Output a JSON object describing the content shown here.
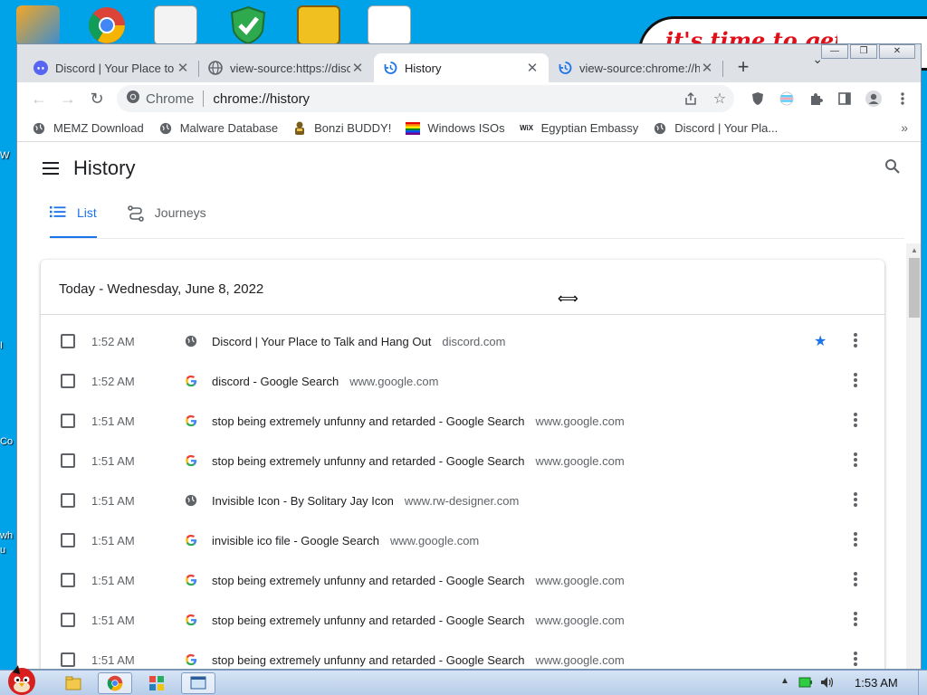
{
  "desktop": {
    "banner_text": "it's time to get chi",
    "left_fragments": [
      "W",
      "I",
      "Co",
      "wh",
      "u"
    ]
  },
  "window": {
    "controls": {
      "minimize": "—",
      "restore": "❐",
      "close": "✕"
    }
  },
  "tabs": [
    {
      "title": "Discord | Your Place to Talk and Hang Out",
      "icon": "discord-icon"
    },
    {
      "title": "view-source:https://discord.com",
      "icon": "globe-icon"
    },
    {
      "title": "History",
      "icon": "history-icon",
      "active": true
    },
    {
      "title": "view-source:chrome://history",
      "icon": "history-icon"
    }
  ],
  "toolbar": {
    "new_tab": "+",
    "tab_search": "⌄",
    "back": "←",
    "forward": "→",
    "reload": "↻",
    "omnibox_label": "Chrome",
    "url": "chrome://history"
  },
  "bookmarks": {
    "items": [
      {
        "label": "MEMZ Download",
        "icon": "globe-icon"
      },
      {
        "label": "Malware Database",
        "icon": "globe-icon"
      },
      {
        "label": "Bonzi BUDDY!",
        "icon": "bonzi-icon"
      },
      {
        "label": "Windows ISOs",
        "icon": "rainbow-flag-icon"
      },
      {
        "label": "Egyptian Embassy",
        "icon": "wix-icon"
      },
      {
        "label": "Discord | Your Pla...",
        "icon": "globe-icon"
      }
    ],
    "more": "»"
  },
  "history": {
    "title": "History",
    "subtabs": [
      {
        "label": "List",
        "active": true
      },
      {
        "label": "Journeys",
        "active": false
      }
    ],
    "day_heading": "Today - Wednesday, June 8, 2022",
    "rows": [
      {
        "time": "1:52 AM",
        "title": "Discord | Your Place to Talk and Hang Out",
        "domain": "discord.com",
        "favicon": "globe",
        "starred": true
      },
      {
        "time": "1:52 AM",
        "title": "discord - Google Search",
        "domain": "www.google.com",
        "favicon": "google",
        "starred": false
      },
      {
        "time": "1:51 AM",
        "title": "stop being extremely unfunny and retarded - Google Search",
        "domain": "www.google.com",
        "favicon": "google",
        "starred": false
      },
      {
        "time": "1:51 AM",
        "title": "stop being extremely unfunny and retarded - Google Search",
        "domain": "www.google.com",
        "favicon": "google",
        "starred": false
      },
      {
        "time": "1:51 AM",
        "title": "Invisible Icon - By Solitary Jay Icon",
        "domain": "www.rw-designer.com",
        "favicon": "globe",
        "starred": false
      },
      {
        "time": "1:51 AM",
        "title": "invisible ico file - Google Search",
        "domain": "www.google.com",
        "favicon": "google",
        "starred": false
      },
      {
        "time": "1:51 AM",
        "title": "stop being extremely unfunny and retarded - Google Search",
        "domain": "www.google.com",
        "favicon": "google",
        "starred": false
      },
      {
        "time": "1:51 AM",
        "title": "stop being extremely unfunny and retarded - Google Search",
        "domain": "www.google.com",
        "favicon": "google",
        "starred": false
      },
      {
        "time": "1:51 AM",
        "title": "stop being extremely unfunny and retarded - Google Search",
        "domain": "www.google.com",
        "favicon": "google",
        "starred": false
      }
    ]
  },
  "taskbar": {
    "clock": "1:53 AM",
    "tray_expand": "▲"
  },
  "colors": {
    "accent": "#1a73e8",
    "desktop": "#00a2e8",
    "banner_text": "#e0101a"
  }
}
